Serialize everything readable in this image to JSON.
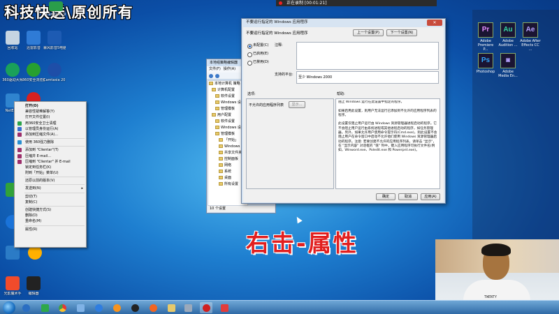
{
  "watermark": "科技快送\\原创所有",
  "recording_bar": {
    "text": "正在录制 [00:01:21]"
  },
  "desktop_icons": [
    {
      "label": "Camtasia 9",
      "color": "#2a9d4a"
    },
    {
      "label": "回收站",
      "color": "#c6d4e2"
    },
    {
      "label": "迅雷影音",
      "color": "#2f7bd6"
    },
    {
      "label": "暴风影音5电脑版",
      "color": "#1d5bb3"
    },
    {
      "label": "360驱动大师",
      "color": "#1aa15a"
    },
    {
      "label": "360安全浏览器",
      "color": "#27a02f"
    },
    {
      "label": "Camtasia 2017 中文",
      "color": "#1e4ea8"
    },
    {
      "label": "NetEase",
      "color": "#2f84cf"
    },
    {
      "label": "",
      "color": "#d62020"
    },
    {
      "label": "360",
      "color": "#31a23a"
    },
    {
      "label": "Kugou",
      "color": "#1a73d9"
    },
    {
      "label": "",
      "color": "#2b7bc6"
    },
    {
      "label": "",
      "color": "#ffb000"
    },
    {
      "label": "光影魔术手",
      "color": "#f14b2b"
    },
    {
      "label": "编辑器",
      "color": "#222222"
    }
  ],
  "adobe_apps": [
    {
      "abbr": "Pr",
      "label": "Adobe Premiere P...",
      "color": "#e48cff"
    },
    {
      "abbr": "Au",
      "label": "Adobe Audition ...",
      "color": "#33d5a2"
    },
    {
      "abbr": "Ae",
      "label": "Adobe After Effects CC ...",
      "color": "#b4a1ff"
    },
    {
      "abbr": "Ps",
      "label": "Photoshop",
      "color": "#31a8ff"
    },
    {
      "abbr": "Ai",
      "label": "Adobe Media En...",
      "color": "#b4a1ff"
    }
  ],
  "context_menu": {
    "items": [
      "打开(O)",
      "兼容性疑难解答(Y)",
      "打开文件位置(I)",
      "用360安全卫士清理",
      "以管理员身份运行(A)",
      "添加到压缩文件(A)...",
      "",
      "使用 360强力删除",
      "",
      "添加到 \"Clientar\"(T)",
      "压缩并 E-mail...",
      "压缩到 \"Clientar\" 并 E-mail",
      "锁定到任务栏(K)",
      "附到「开始」菜单(U)",
      "",
      "还原以前的版本(V)",
      "",
      "发送到(N)",
      "",
      "剪切(T)",
      "复制(C)",
      "",
      "创建快捷方式(S)",
      "删除(D)",
      "重命名(M)",
      "",
      "属性(R)"
    ]
  },
  "explorer": {
    "title": "本地组策略编辑器",
    "menu": [
      "文件(F)",
      "操作(A)"
    ],
    "tree": [
      "本地计算机 策略",
      "计算机配置",
      "软件设置",
      "Windows 设置",
      "管理模板",
      "用户配置",
      "软件设置",
      "Windows 设置",
      "管理模板",
      "「开始」",
      "Windows",
      "共享文件夹",
      "控制面板",
      "网络",
      "系统",
      "桌面",
      "所有设置"
    ],
    "status": "10 个设置"
  },
  "dialog": {
    "title": "不要运行指定的 Windows 应用程序",
    "heading": "不要运行指定的 Windows 应用程序",
    "prev_button": "上一个设置(P)",
    "next_button": "下一个设置(N)",
    "radio_not_configured": "未配置(C)",
    "radio_enabled": "已启用(E)",
    "radio_disabled": "已禁用(D)",
    "comment_label": "注释:",
    "supported_label": "支持的平台:",
    "supported_value": "至少 Windows 2000",
    "options_label": "选项:",
    "help_label": "帮助:",
    "option_row": "不允许的应用程序列表",
    "show_button": "显示...",
    "help_text": "阻止 Windows 运行在此设置中指定的程序。\n\n如果启用此设置，则用户无法运行已添加到不允许的应用程序列表的程序。\n\n此设置仅阻止用户运行由 Windows 资源管理器进程启动的程序。它不会阻止用户运行由系统进程或其他进程启动的程序，如任务管理器。另外，如果允许用户使用命令提示符(Cmd.exe)，则此设置不会阻止用户在命令窗口中启动不允许他们使用 Windows 资源管理器启动的程序。注意: 若要创建不允许的应用程序列表，请单击 \"显示\"，在 \"显示内容\" 对话框的 \"值\" 列中，键入应用程序可执行文件名(例如，Winword.exe、Poledit.exe 和 Powerpnt.exe)。",
    "ok_button": "确定",
    "cancel_button": "取消",
    "apply_button": "应用(A)"
  },
  "caption": "右击-属性",
  "webcam": {
    "shirt_text": "TWENTY"
  },
  "colors": {
    "caption_red": "#e21f1f",
    "desktop_blue": "#1e7fd0"
  }
}
